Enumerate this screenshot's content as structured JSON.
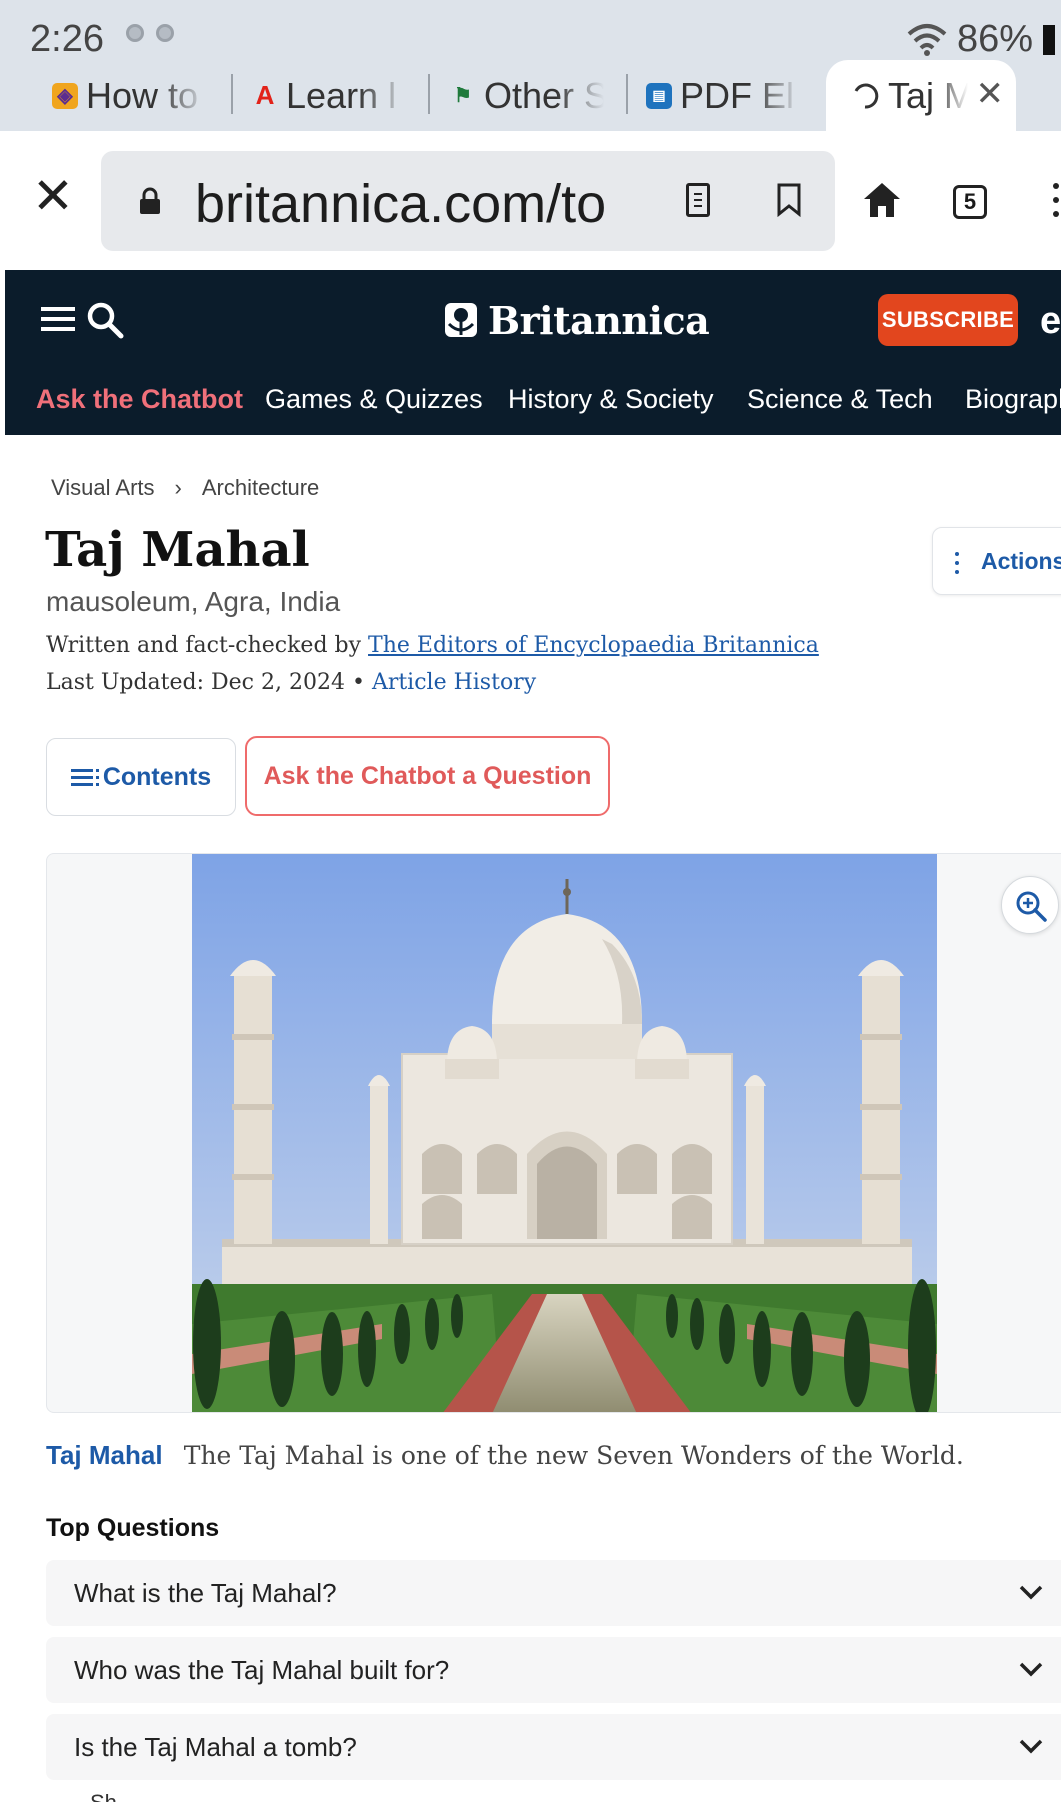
{
  "status_bar": {
    "time": "2:26",
    "battery": "86%"
  },
  "tabs": [
    {
      "label": "How to",
      "icon": "colorful-favicon",
      "color": "#f0a51e"
    },
    {
      "label": "Learn l",
      "icon": "adobe-favicon",
      "color": "#e2231a"
    },
    {
      "label": "Other S",
      "icon": "flag-favicon",
      "color": "#1f7a3c"
    },
    {
      "label": "PDF El",
      "icon": "document-favicon",
      "color": "#1e73be"
    },
    {
      "label": "Taj M",
      "icon": "loading-icon",
      "active": true
    }
  ],
  "address_bar": {
    "url": "britannica.com/to",
    "tabs_count": "5"
  },
  "site": {
    "brand": "Britannica",
    "subscribe_label": "SUBSCRIBE",
    "nav": [
      "Ask the Chatbot",
      "Games & Quizzes",
      "History & Society",
      "Science & Tech",
      "Biographi"
    ]
  },
  "article": {
    "breadcrumb": [
      "Visual Arts",
      "Architecture"
    ],
    "title": "Taj Mahal",
    "subtitle": "mausoleum, Agra, India",
    "byline_prefix": "Written and fact-checked by",
    "byline_link": "The Editors of Encyclopaedia Britannica",
    "updated_prefix": "Last Updated: Dec 2, 2024 •",
    "history_link": "Article History",
    "actions_label": "Actions",
    "contents_label": "Contents",
    "chatbot_button_label": "Ask the Chatbot a Question",
    "caption_title": "Taj Mahal",
    "caption_text": "The Taj Mahal is one of the new Seven Wonders of the World."
  },
  "top_questions": {
    "heading": "Top Questions",
    "items": [
      "What is the Taj Mahal?",
      "Who was the Taj Mahal built for?",
      "Is the Taj Mahal a tomb?"
    ],
    "next_peek": "Sh"
  },
  "colors": {
    "header_bg": "#0b1c2b",
    "accent_blue": "#1d5aa7",
    "subscribe": "#e2461e",
    "chatbot_red": "#e05a5a"
  }
}
